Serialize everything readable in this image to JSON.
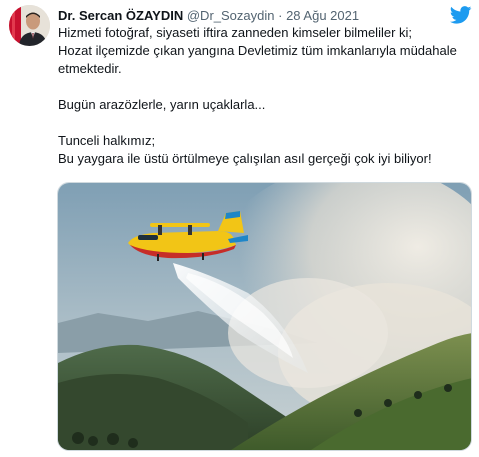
{
  "author": {
    "display_name": "Dr. Sercan ÖZAYDIN",
    "handle": "@Dr_Sozaydin",
    "separator": "·",
    "date": "28 Ağu 2021"
  },
  "tweet": {
    "lines_block1": [
      "Hizmeti fotoğraf, siyaseti iftira zanneden kimseler bilmeliler ki;",
      "Hozat ilçemizde çıkan yangına Devletimiz tüm imkanlarıyla müdahale",
      "etmektedir."
    ],
    "line_block2": "Bugün arazözlerle, yarın uçaklarla...",
    "lines_block3": [
      "Tunceli halkımız;",
      "Bu yaygara ile üstü örtülmeye çalışılan asıl gerçeği çok iyi biliyor!"
    ]
  },
  "icons": {
    "brand": "twitter-bird-icon",
    "brand_color": "#1d9bf0"
  },
  "colors": {
    "text": "#0f1419",
    "secondary": "#536471",
    "border": "#cfd9de"
  }
}
